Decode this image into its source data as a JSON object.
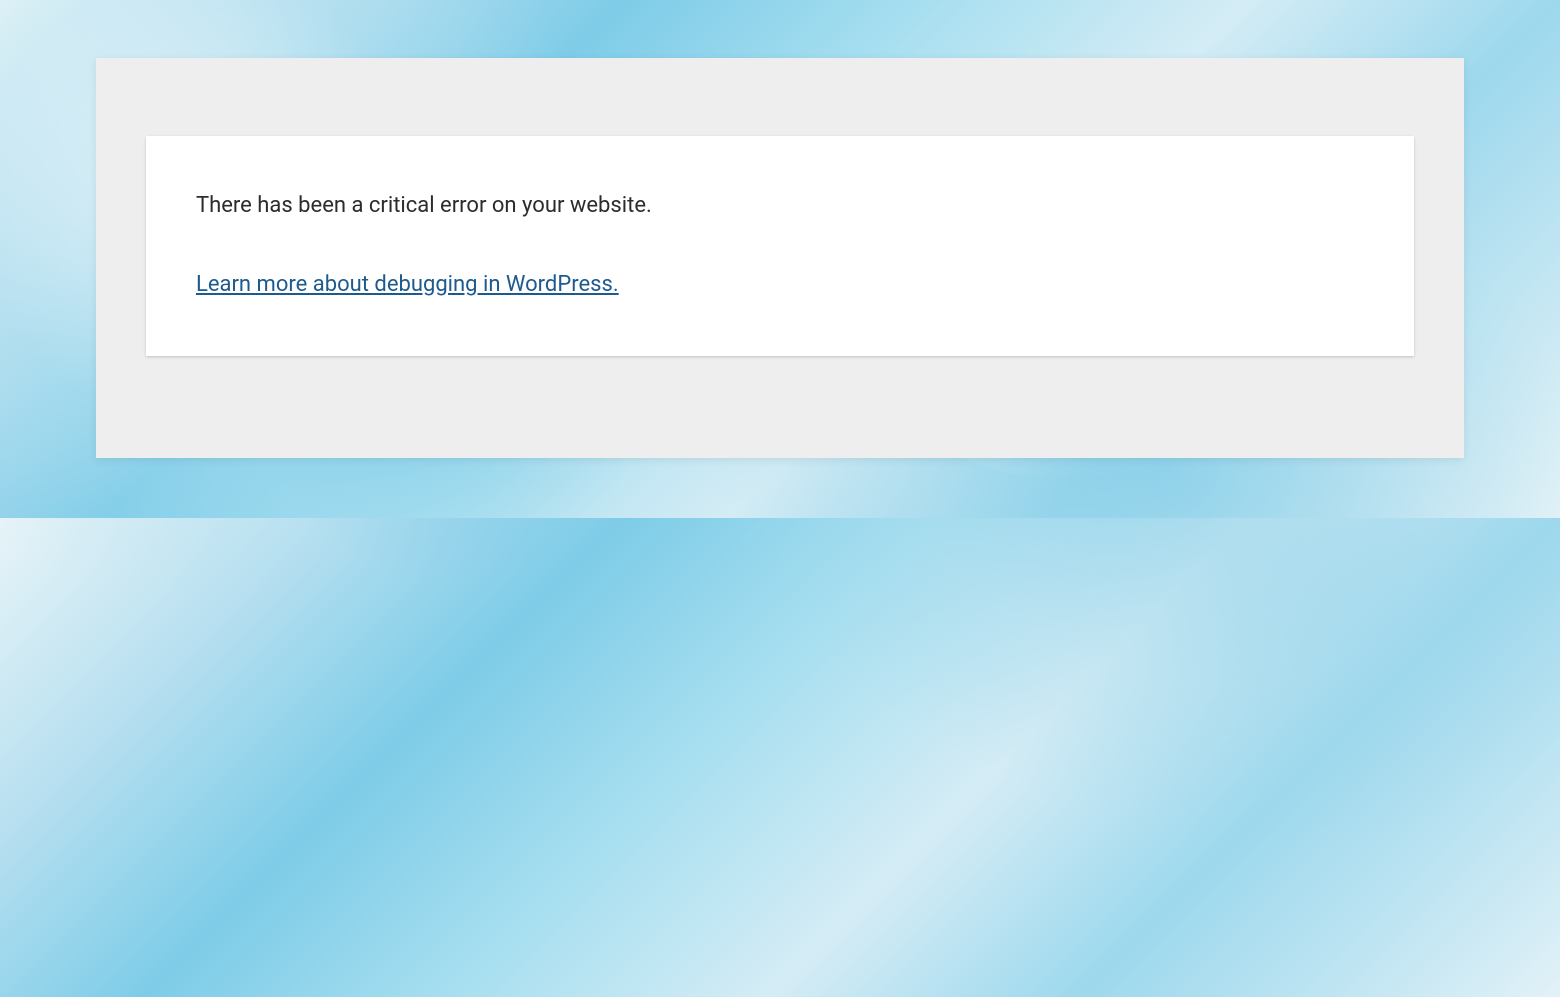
{
  "error": {
    "message": "There has been a critical error on your website.",
    "link_text": "Learn more about debugging in WordPress."
  }
}
